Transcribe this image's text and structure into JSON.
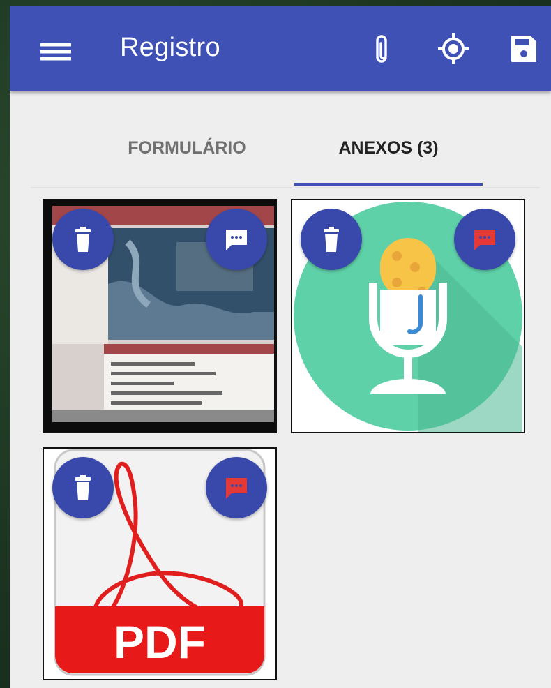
{
  "appbar": {
    "title": "Registro",
    "icons": [
      "menu-icon",
      "paperclip-icon",
      "gps-fixed-icon",
      "save-icon"
    ]
  },
  "tabs": [
    {
      "label": "FORMULÁRIO",
      "active": false
    },
    {
      "label": "ANEXOS (3)",
      "active": true
    }
  ],
  "attachments": [
    {
      "kind": "photo",
      "has_comment": false
    },
    {
      "kind": "audio",
      "has_comment": true
    },
    {
      "kind": "pdf",
      "label": "PDF",
      "has_comment": true
    }
  ],
  "colors": {
    "primary": "#3f51b5",
    "fab": "#3949ab",
    "comment_flag": "#e53935",
    "background": "#eeeeee"
  }
}
